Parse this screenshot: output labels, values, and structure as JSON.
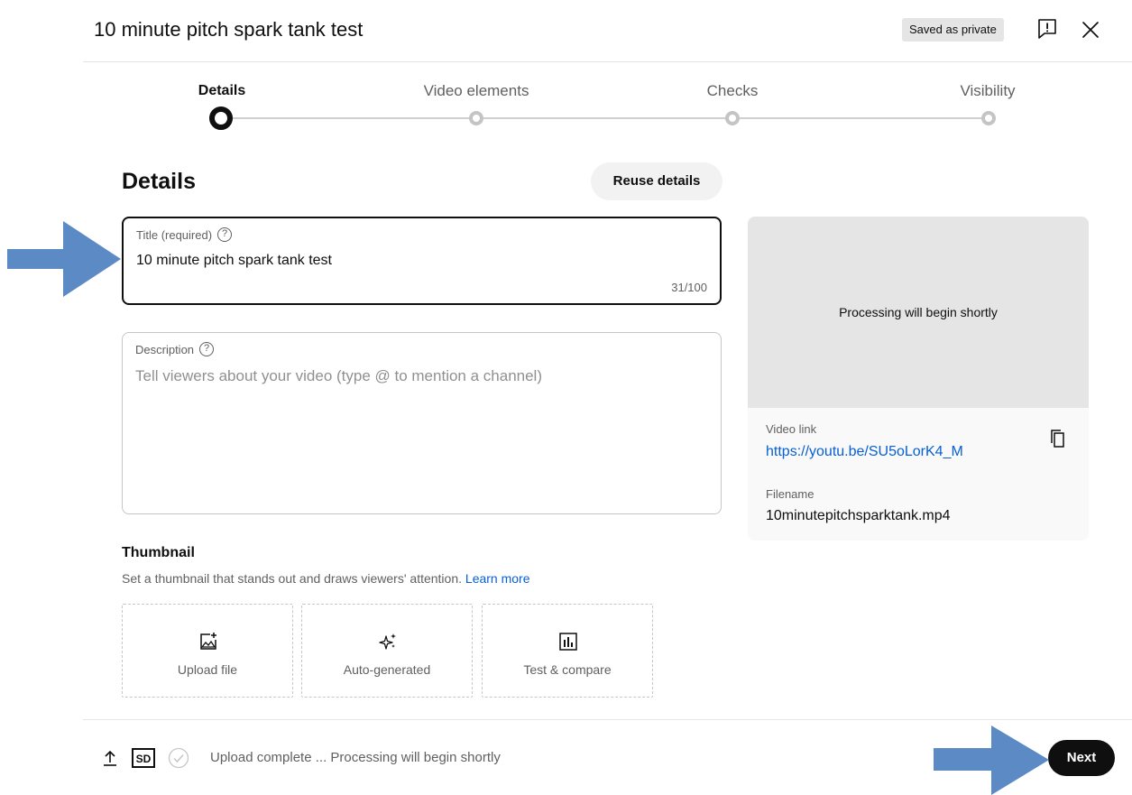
{
  "header": {
    "title": "10 minute pitch spark tank test",
    "saved_badge": "Saved as private",
    "feedback_icon": "feedback-icon",
    "close_icon": "close-icon"
  },
  "stepper": {
    "steps": [
      {
        "label": "Details",
        "active": true
      },
      {
        "label": "Video elements",
        "active": false
      },
      {
        "label": "Checks",
        "active": false
      },
      {
        "label": "Visibility",
        "active": false
      }
    ]
  },
  "details": {
    "heading": "Details",
    "reuse_button": "Reuse details",
    "title_field": {
      "label": "Title (required)",
      "value": "10 minute pitch spark tank test",
      "char_count": "31/100"
    },
    "description_field": {
      "label": "Description",
      "placeholder": "Tell viewers about your video (type @ to mention a channel)"
    }
  },
  "preview": {
    "processing_text": "Processing will begin shortly",
    "video_link_label": "Video link",
    "video_link": "https://youtu.be/SU5oLorK4_M",
    "filename_label": "Filename",
    "filename": "10minutepitchsparktank.mp4"
  },
  "thumbnail": {
    "heading": "Thumbnail",
    "description": "Set a thumbnail that stands out and draws viewers' attention.",
    "learn_more": "Learn more",
    "options": [
      {
        "label": "Upload file",
        "icon": "image-add-icon"
      },
      {
        "label": "Auto-generated",
        "icon": "sparkle-icon"
      },
      {
        "label": "Test & compare",
        "icon": "bar-chart-icon"
      }
    ]
  },
  "footer": {
    "sd_label": "SD",
    "status": "Upload complete ... Processing will begin shortly",
    "next_button": "Next"
  },
  "colors": {
    "accent_link": "#065fd4",
    "annotation_arrow": "#5b8ac5",
    "primary_button": "#0f0f0f"
  }
}
